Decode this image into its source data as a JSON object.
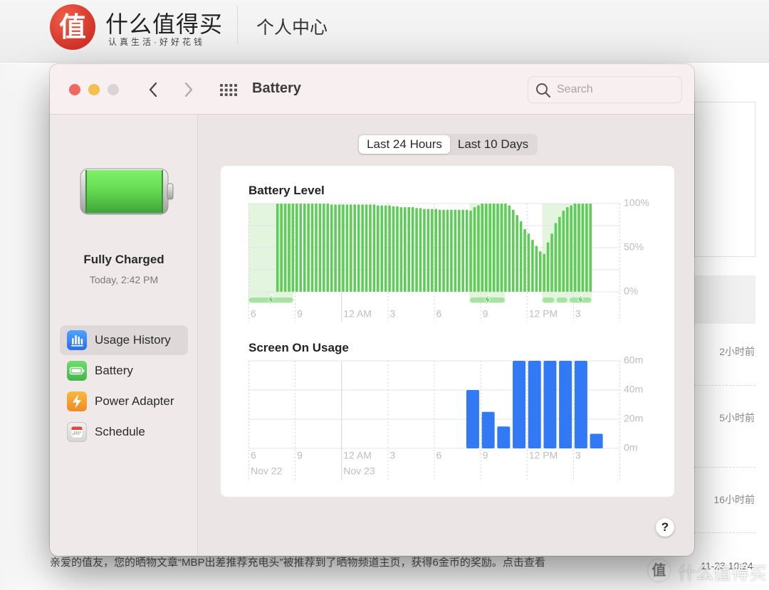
{
  "site": {
    "logo_char": "值",
    "name": "什么值得买",
    "slogan": "认真生活·好好花钱",
    "section_title": "个人中心",
    "message_times": [
      "2小时前",
      "5小时前",
      "16小时前"
    ],
    "notice_text": "亲爱的值友，您的晒物文章“MBP出差推荐充电头”被推荐到了晒物频道主页，获得6金币的奖励。点击查看",
    "notice_time": "11-23 10:24",
    "watermark_logo": "值",
    "watermark_text": "什么值得买",
    "brand_color": "#d8352a"
  },
  "window": {
    "title": "Battery",
    "search_placeholder": "Search",
    "search_value": "",
    "traffic_lights": {
      "close": "#ec6a5e",
      "minimize": "#f4bf4f",
      "zoom": "#dbd4d5"
    },
    "icons": {
      "back": "chevron-left-icon",
      "forward": "chevron-right-icon",
      "grid": "show-all-grid-icon",
      "search": "search-icon"
    }
  },
  "sidebar": {
    "status_title": "Fully Charged",
    "status_time": "Today, 2:42 PM",
    "battery_percent": 100,
    "items": [
      {
        "label": "Usage History",
        "icon": "usage-history-icon",
        "selected": true
      },
      {
        "label": "Battery",
        "icon": "battery-icon",
        "selected": false
      },
      {
        "label": "Power Adapter",
        "icon": "power-adapter-icon",
        "selected": false
      },
      {
        "label": "Schedule",
        "icon": "schedule-icon",
        "selected": false
      }
    ]
  },
  "segmented": {
    "options": [
      {
        "label": "Last 24 Hours",
        "selected": true
      },
      {
        "label": "Last 10 Days",
        "selected": false
      }
    ]
  },
  "help_label": "?",
  "chart_data": [
    {
      "type": "bar",
      "title": "Battery Level",
      "x_unit": "15-minute intervals, starting 6 PM Nov 22",
      "x_range_hours": [
        0,
        24
      ],
      "values": [
        null,
        null,
        null,
        null,
        null,
        null,
        null,
        100,
        100,
        100,
        100,
        100,
        100,
        100,
        100,
        100,
        100,
        100,
        100,
        100,
        100,
        99,
        99,
        99,
        99,
        99,
        99,
        99,
        99,
        99,
        99,
        99,
        99,
        98,
        98,
        98,
        98,
        97,
        97,
        96,
        96,
        96,
        96,
        95,
        95,
        94,
        94,
        94,
        94,
        93,
        93,
        93,
        93,
        93,
        93,
        93,
        93,
        92,
        96,
        98,
        100,
        100,
        100,
        100,
        100,
        100,
        100,
        98,
        93,
        87,
        80,
        71,
        66,
        59,
        52,
        46,
        43,
        56,
        66,
        78,
        85,
        92,
        96,
        98,
        100,
        100,
        100,
        100,
        100,
        null,
        null,
        null,
        null,
        null,
        null,
        null
      ],
      "ylim": [
        0,
        100
      ],
      "y_ticks": [
        {
          "value": 100,
          "label": "100%"
        },
        {
          "value": 50,
          "label": "50%"
        },
        {
          "value": 0,
          "label": "0%"
        }
      ],
      "y_grid": [
        0,
        25,
        50,
        75,
        100
      ],
      "x_ticks": [
        {
          "hour": 0,
          "label": "6"
        },
        {
          "hour": 3,
          "label": "9"
        },
        {
          "hour": 6,
          "label": "12 AM"
        },
        {
          "hour": 9,
          "label": "3"
        },
        {
          "hour": 12,
          "label": "6"
        },
        {
          "hour": 15,
          "label": "9"
        },
        {
          "hour": 18,
          "label": "12 PM"
        },
        {
          "hour": 21,
          "label": "3"
        }
      ],
      "midnight_hour": 6,
      "charging_shade_hours": [
        [
          0,
          2.9
        ],
        [
          14.3,
          16.6
        ],
        [
          19.0,
          22.2
        ]
      ],
      "charging_segments_hours": [
        {
          "range": [
            0,
            2.9
          ],
          "bolt": true
        },
        {
          "range": [
            14.3,
            16.6
          ],
          "bolt": true
        },
        {
          "range": [
            19.0,
            19.8
          ],
          "bolt": false
        },
        {
          "range": [
            19.9,
            20.65
          ],
          "bolt": false
        },
        {
          "range": [
            20.75,
            22.2
          ],
          "bolt": true
        }
      ],
      "colors": {
        "bar": "#5fcb59",
        "shade": "#e3f5df",
        "charging": "#a6e3a0",
        "bolt": "#47bf44"
      },
      "grid": true,
      "legend": "none"
    },
    {
      "type": "bar",
      "title": "Screen On Usage",
      "x_unit": "hourly bins, starting 6 PM Nov 22",
      "x_range_hours": [
        0,
        24
      ],
      "values": [
        0,
        0,
        0,
        0,
        0,
        0,
        0,
        0,
        0,
        0,
        0,
        0,
        0,
        0,
        40,
        25,
        15,
        60,
        60,
        60,
        60,
        60,
        10,
        0
      ],
      "value_unit": "minutes",
      "ylim": [
        0,
        60
      ],
      "y_ticks": [
        {
          "value": 60,
          "label": "60m"
        },
        {
          "value": 40,
          "label": "40m"
        },
        {
          "value": 20,
          "label": "20m"
        },
        {
          "value": 0,
          "label": "0m"
        }
      ],
      "x_ticks": [
        {
          "hour": 0,
          "label": "6"
        },
        {
          "hour": 3,
          "label": "9"
        },
        {
          "hour": 6,
          "label": "12 AM"
        },
        {
          "hour": 9,
          "label": "3"
        },
        {
          "hour": 12,
          "label": "6"
        },
        {
          "hour": 15,
          "label": "9"
        },
        {
          "hour": 18,
          "label": "12 PM"
        },
        {
          "hour": 21,
          "label": "3"
        }
      ],
      "date_labels": [
        {
          "hour": 0,
          "label": "Nov 22"
        },
        {
          "hour": 6,
          "label": "Nov 23"
        }
      ],
      "midnight_hour": 6,
      "colors": {
        "bar": "#3179f5"
      },
      "grid": true,
      "legend": "none"
    }
  ]
}
